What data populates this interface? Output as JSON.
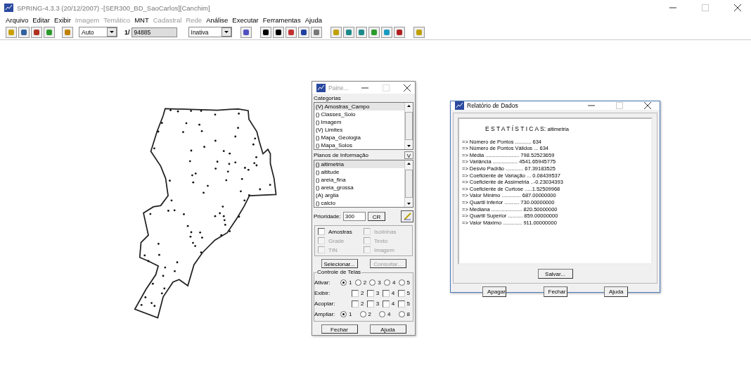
{
  "window": {
    "title": "SPRING-4.3.3 (20/12/2007) -[SER300_BD_SaoCarlos][Canchim]"
  },
  "menu": [
    {
      "label": "Arquivo",
      "disabled": false
    },
    {
      "label": "Editar",
      "disabled": false
    },
    {
      "label": "Exibir",
      "disabled": false
    },
    {
      "label": "Imagem",
      "disabled": true
    },
    {
      "label": "Temático",
      "disabled": true
    },
    {
      "label": "MNT",
      "disabled": false
    },
    {
      "label": "Cadastral",
      "disabled": true
    },
    {
      "label": "Rede",
      "disabled": true
    },
    {
      "label": "Análise",
      "disabled": false
    },
    {
      "label": "Executar",
      "disabled": false
    },
    {
      "label": "Ferramentas",
      "disabled": false
    },
    {
      "label": "Ajuda",
      "disabled": false
    }
  ],
  "toolbar": {
    "mode": "Auto",
    "scale_label": "1/",
    "scale": "94885",
    "state": "Inativa"
  },
  "panel": {
    "title": "Paine...",
    "categories_label": "Categorias",
    "categories": [
      {
        "label": "(V) Amostras_Campo",
        "selected": true
      },
      {
        "label": "() Classes_Solo",
        "selected": false
      },
      {
        "label": "() Imagem",
        "selected": false
      },
      {
        "label": "(V) Limites",
        "selected": false
      },
      {
        "label": "() Mapa_Geologia",
        "selected": false
      },
      {
        "label": "() Mapa_Solos",
        "selected": false
      }
    ],
    "planes_label": "Planos de Informação",
    "planes_button": "V",
    "planes": [
      {
        "label": "() altimetria",
        "selected": true
      },
      {
        "label": "() altitude",
        "selected": false
      },
      {
        "label": "() areia_fina",
        "selected": false
      },
      {
        "label": "() areia_grossa",
        "selected": false
      },
      {
        "label": "(A) argila",
        "selected": false
      },
      {
        "label": "() calcio",
        "selected": false
      }
    ],
    "priority_label": "Prioridade:",
    "priority": "300",
    "cr_button": "CR",
    "options": [
      {
        "label": "Amostras",
        "checked": false,
        "disabled": false
      },
      {
        "label": "Isolinhas",
        "checked": false,
        "disabled": true
      },
      {
        "label": "Grade",
        "checked": false,
        "disabled": true
      },
      {
        "label": "Texto",
        "checked": false,
        "disabled": true
      },
      {
        "label": "TIN",
        "checked": false,
        "disabled": true
      },
      {
        "label": "Imagem",
        "checked": false,
        "disabled": true
      }
    ],
    "select_button": {
      "label": "Selecionar...",
      "disabled": false
    },
    "query_button": {
      "label": "Consultar...",
      "disabled": true
    },
    "screens_title": "Controle de Telas",
    "screens": [
      {
        "label": "Ativar:",
        "kind": "radio",
        "options": [
          {
            "label": "1",
            "selected": true
          },
          {
            "label": "2",
            "selected": false
          },
          {
            "label": "3",
            "selected": false
          },
          {
            "label": "4",
            "selected": false
          },
          {
            "label": "5",
            "selected": false
          }
        ]
      },
      {
        "label": "Exibir:",
        "kind": "check",
        "options": [
          {
            "label": "2",
            "checked": false
          },
          {
            "label": "3",
            "checked": false
          },
          {
            "label": "4",
            "checked": false
          },
          {
            "label": "5",
            "checked": false
          }
        ]
      },
      {
        "label": "Acoplar:",
        "kind": "check",
        "options": [
          {
            "label": "2",
            "checked": false
          },
          {
            "label": "3",
            "checked": false
          },
          {
            "label": "4",
            "checked": false
          },
          {
            "label": "5",
            "checked": false
          }
        ]
      },
      {
        "label": "Ampliar:",
        "kind": "radio",
        "options": [
          {
            "label": "1",
            "selected": true
          },
          {
            "label": "2",
            "selected": false
          },
          {
            "label": "4",
            "selected": false
          },
          {
            "label": "8",
            "selected": false
          }
        ]
      }
    ],
    "buttons": [
      "Fechar",
      "Ajuda"
    ]
  },
  "report": {
    "title": "Relatório de Dados",
    "heading": "E S T A T Í S T I C A S:",
    "subject": "altimetria",
    "lines": [
      "=> Número de Pontos ........... 634",
      "=> Número de Pontos Válidos ... 634",
      "=> Média ....................... 798.52523659",
      "=> Variância ................. 4541.65945775",
      "=> Desvio Padrão ............ 67.39183525",
      "=> Coeficiente de Variação ... 0.08439537",
      "=> Coeficiente de Assimetria ..-0.23034393",
      "=> Coeficiente de Curtose .....1.52509968",
      "=> Valor Mínimo ............. 687.00000000",
      "=> Quartil Inferior .......... 730.00000000",
      "=> Mediana ..................... 820.50000000",
      "=> Quartil Superior .......... 859.00000000",
      "=> Valor Máximo ............. 911.00000000"
    ],
    "save_button": "Salvar...",
    "buttons": [
      "Apagar",
      "Fechar",
      "Ajuda"
    ]
  }
}
